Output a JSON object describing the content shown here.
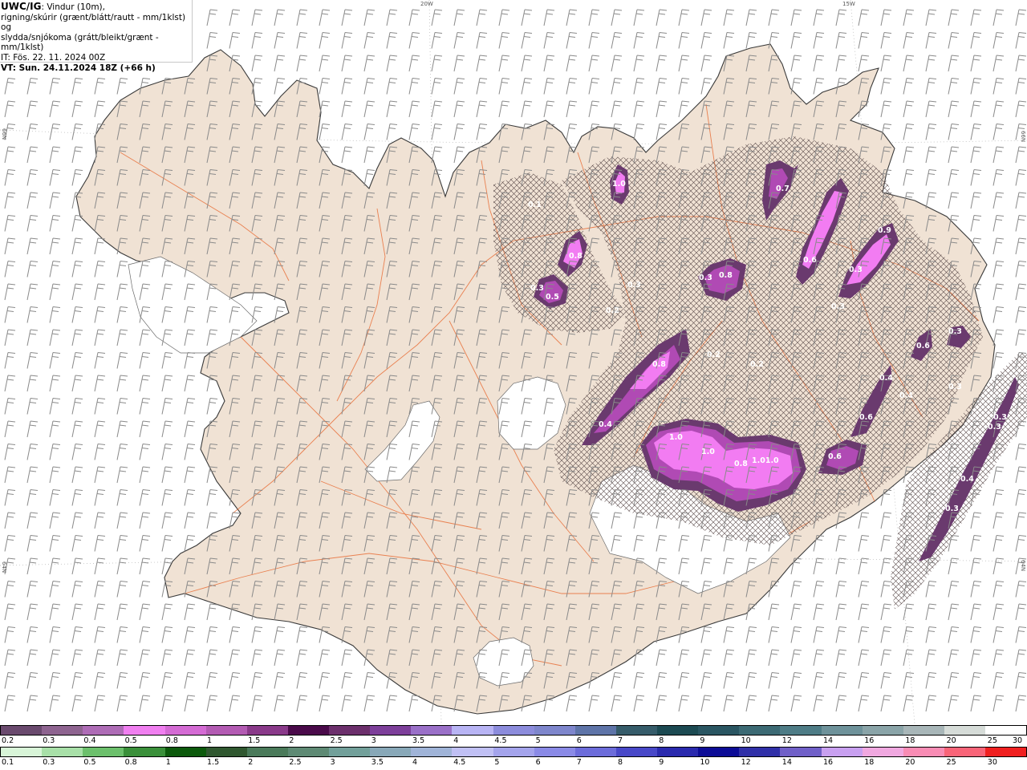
{
  "info": {
    "model": "UWC/IG",
    "line1_rest": ": Vindur (10m),",
    "line2": "rigning/skúrir (grænt/blátt/rautt - mm/1klst) og",
    "line3": "slydda/snjókoma (grátt/bleikt/grænt - mm/1klst)",
    "line4": "IT: Fös. 22. 11. 2024 00Z",
    "line5": "VT: Sun. 24.11.2024 18Z (+66 h)"
  },
  "grid_labels": {
    "top_left": "20W",
    "top_right": "15W",
    "left_upper": "66N",
    "left_lower": "64N",
    "right_upper": "66N",
    "right_lower": "64N"
  },
  "colors": {
    "land": "#f0e2d4",
    "coast": "#3a3a3a",
    "roads": "#e8703a",
    "glacier": "#ffffff",
    "barb": "#8a8a8a",
    "snow_light": "#f27cf2",
    "snow_mid": "#b04ab4",
    "snow_dark": "#6a3a6e"
  },
  "precip_labels": [
    "0.1",
    "0.8",
    "1.0",
    "0.3",
    "0.5",
    "0.3",
    "0.2",
    "0.3",
    "0.8",
    "0.7",
    "0.6",
    "0.3",
    "0.9",
    "0.8",
    "0.4",
    "1.0",
    "1.0",
    "0.8",
    "1.01.0",
    "0.6",
    "0.6",
    "0.6",
    "0.4",
    "0.4",
    "0.3",
    "0.3",
    "0.3",
    "0.3",
    "0.4",
    "0.3",
    "0.3",
    "0.2",
    "0.2"
  ],
  "legend": {
    "snow_swatches": [
      "#6a4a6e",
      "#8e6490",
      "#ae6cb6",
      "#f07ff0",
      "#d46bd4",
      "#b35bb3",
      "#8a3a8a",
      "#4a0a4a",
      "#6c2f6c",
      "#7d3f9a",
      "#9a70c8",
      "#b8b4f4",
      "#8c8cdc",
      "#7e86cc",
      "#5e74a8",
      "#365c6a",
      "#1c4a52",
      "#2a5662",
      "#3c6a74",
      "#4e7c86",
      "#6e929a",
      "#8aa4a8",
      "#a8b6b8",
      "#d6dcd8",
      "#ffffff"
    ],
    "snow_labels": [
      "0.2",
      "0.3",
      "0.4",
      "0.5",
      "0.8",
      "1",
      "1.5",
      "2",
      "2.5",
      "3",
      "3.5",
      "4",
      "4.5",
      "5",
      "6",
      "7",
      "8",
      "9",
      "10",
      "12",
      "14",
      "16",
      "18",
      "20",
      "25",
      "30"
    ],
    "rain_swatches": [
      "#d8f5d8",
      "#a8e0a8",
      "#6cc06c",
      "#3a903a",
      "#0c5a0c",
      "#305830",
      "#4a7a5a",
      "#5e8a74",
      "#72a09a",
      "#88a8b8",
      "#a0b4d8",
      "#c0c0f4",
      "#a4a4ec",
      "#8a8ae6",
      "#6c6cda",
      "#4848c8",
      "#2a2aae",
      "#0c0c96",
      "#3030a8",
      "#7060c8",
      "#c8a0f0",
      "#f0a8e0",
      "#f88cb4",
      "#f86478",
      "#f02020"
    ],
    "rain_labels": [
      "0.1",
      "0.3",
      "0.5",
      "0.8",
      "1",
      "1.5",
      "2",
      "2.5",
      "3",
      "3.5",
      "4",
      "4.5",
      "5",
      "6",
      "7",
      "8",
      "9",
      "10",
      "12",
      "14",
      "16",
      "18",
      "20",
      "25",
      "30"
    ]
  }
}
